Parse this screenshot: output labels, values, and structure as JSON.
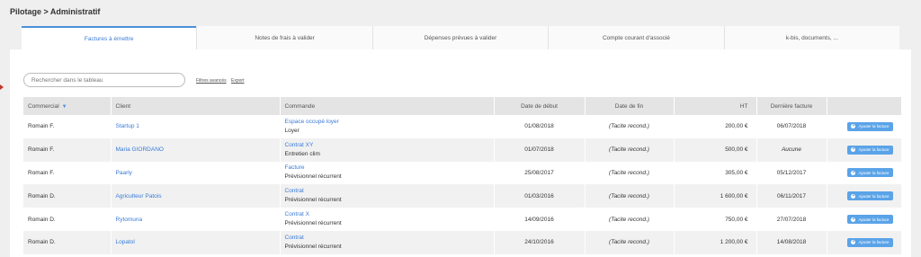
{
  "breadcrumb": "Pilotage > Administratif",
  "tabs": [
    {
      "label": "Factures à émettre",
      "active": true
    },
    {
      "label": "Notes de frais à valider",
      "active": false
    },
    {
      "label": "Dépenses prévues à valider",
      "active": false
    },
    {
      "label": "Compte courant d'associé",
      "active": false
    },
    {
      "label": "k-bis, documents, ...",
      "active": false
    }
  ],
  "search": {
    "placeholder": "Rechercher dans le tableau",
    "value": ""
  },
  "links": {
    "filters": "Filtres avancés",
    "export": "Export"
  },
  "table": {
    "headers": {
      "commercial": "Commercial",
      "client": "Client",
      "commande": "Commande",
      "date_debut": "Date de début",
      "date_fin": "Date de fin",
      "ht": "HT",
      "derniere_facture": "Dernière facture"
    },
    "sort_icon": "sort-down-icon",
    "rows": [
      {
        "commercial": "Romain F.",
        "client": "Startup 1",
        "commande": "Espace occupé loyer",
        "commande_sub": "Loyer",
        "date_debut": "01/08/2018",
        "date_fin": "(Tacite recond.)",
        "ht": "200,00 €",
        "derniere_facture": "06/07/2018",
        "derniere_italic": false,
        "action": "Ajouter la facture"
      },
      {
        "commercial": "Romain F.",
        "client": "Maria GIORDANO",
        "commande": "Contrat XY",
        "commande_sub": "Entretien clim",
        "date_debut": "01/07/2018",
        "date_fin": "(Tacite recond.)",
        "ht": "500,00 €",
        "derniere_facture": "Aucune",
        "derniere_italic": true,
        "action": "Ajouter la facture"
      },
      {
        "commercial": "Romain F.",
        "client": "Paarly",
        "commande": "Facture",
        "commande_sub": "Prévisionnel récurrent",
        "date_debut": "25/08/2017",
        "date_fin": "(Tacite recond.)",
        "ht": "305,00 €",
        "derniere_facture": "05/12/2017",
        "derniere_italic": false,
        "action": "Ajouter la facture"
      },
      {
        "commercial": "Romain D.",
        "client": "Agriculteur Patois",
        "commande": "Contrat",
        "commande_sub": "Prévisionnel récurrent",
        "date_debut": "01/03/2016",
        "date_fin": "(Tacite recond.)",
        "ht": "1 600,00 €",
        "derniere_facture": "06/11/2017",
        "derniere_italic": false,
        "action": "Ajouter la facture"
      },
      {
        "commercial": "Romain D.",
        "client": "Rytomuna",
        "commande": "Contrat X",
        "commande_sub": "Prévisionnel récurrent",
        "date_debut": "14/09/2016",
        "date_fin": "(Tacite recond.)",
        "ht": "750,00 €",
        "derniere_facture": "27/07/2018",
        "derniere_italic": false,
        "action": "Ajouter la facture"
      },
      {
        "commercial": "Romain D.",
        "client": "Lopatol",
        "commande": "Contrat",
        "commande_sub": "Prévisionnel récurrent",
        "date_debut": "24/10/2016",
        "date_fin": "(Tacite recond.)",
        "ht": "1 200,00 €",
        "derniere_facture": "14/08/2018",
        "derniere_italic": false,
        "action": "Ajouter la facture"
      }
    ]
  },
  "colors": {
    "accent": "#4a90d9",
    "link": "#3a7bd5",
    "button": "#5aa3e8"
  }
}
